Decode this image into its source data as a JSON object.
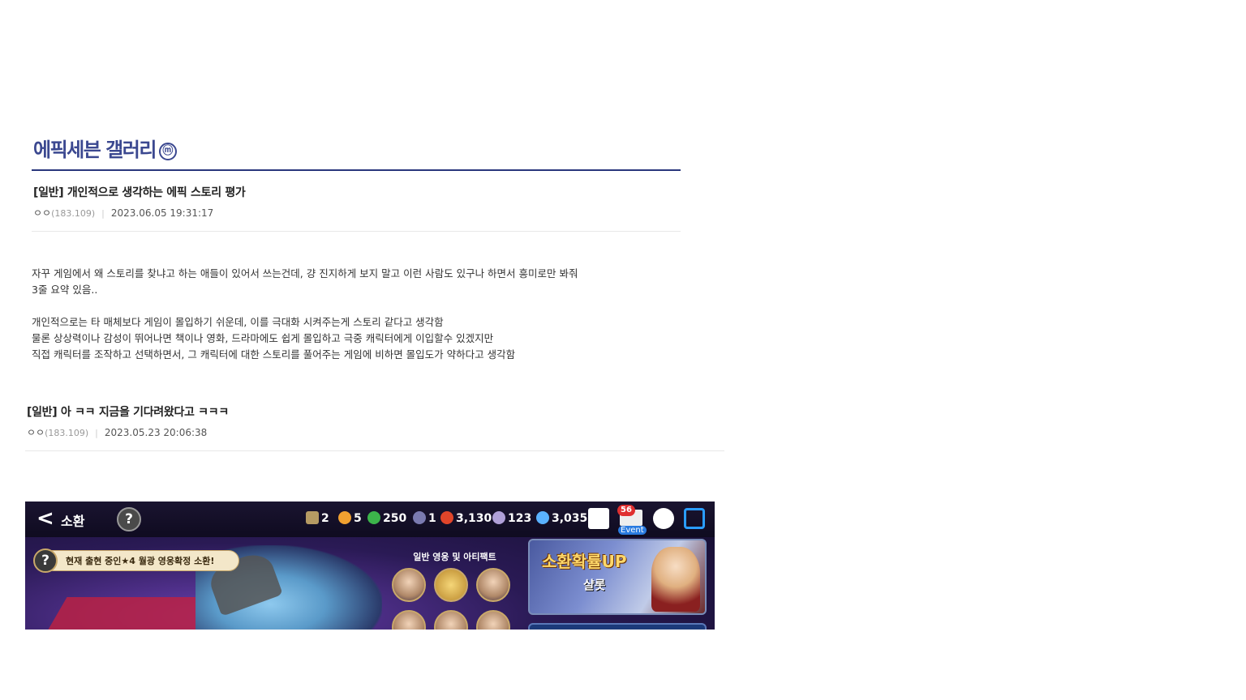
{
  "gallery": {
    "title": "에픽세븐 갤러리",
    "badge": "ⓜ"
  },
  "posts": [
    {
      "title": "[일반] 개인적으로 생각하는 에픽 스토리 평가",
      "writer": "ㅇㅇ",
      "ip": "(183.109)",
      "date": "2023.06.05 19:31:17",
      "body": [
        "자꾸 게임에서 왜 스토리를 찾냐고 하는 애들이 있어서 쓰는건데, 걍 진지하게 보지 말고 이런 사람도 있구나 하면서 흥미로만 봐줘",
        "3줄 요약 있음..",
        "",
        "개인적으로는 타 매체보다 게임이 몰입하기 쉬운데, 이를 극대화 시켜주는게 스토리 같다고 생각함",
        "물론 상상력이나 감성이 뛰어나면 책이나 영화, 드라마에도 쉽게 몰입하고 극중 캐릭터에게 이입할수 있겠지만",
        "직접 캐릭터를 조작하고 선택하면서, 그 캐릭터에 대한 스토리를 풀어주는 게임에 비하면 몰입도가 약하다고 생각함"
      ]
    },
    {
      "title": "[일반] 아 ㅋㅋ 지금을 기다려왔다고 ㅋㅋㅋ",
      "writer": "ㅇㅇ",
      "ip": "(183.109)",
      "date": "2023.05.23 20:06:38"
    }
  ],
  "banner": {
    "back_icon": "<",
    "screen_title": "소환",
    "help_label": "?",
    "resources": [
      {
        "icon": "book-icon",
        "value": "2"
      },
      {
        "icon": "flame-icon",
        "value": "5"
      },
      {
        "icon": "leaf-icon",
        "value": "250"
      },
      {
        "icon": "orb-icon",
        "value": "1"
      },
      {
        "icon": "ember-icon",
        "value": "3,130"
      },
      {
        "icon": "bolt-icon",
        "value": "123"
      },
      {
        "icon": "gem-icon",
        "value": "3,035"
      }
    ],
    "mail_count": "56",
    "event_label": "Event",
    "notice_text": "현재 출현 중인★4 월광 영웅확정 소환!",
    "panel_title": "일반 영웅 및 아티팩트",
    "side_title": "소환확률UP",
    "side_subtitle": "샬롯"
  }
}
